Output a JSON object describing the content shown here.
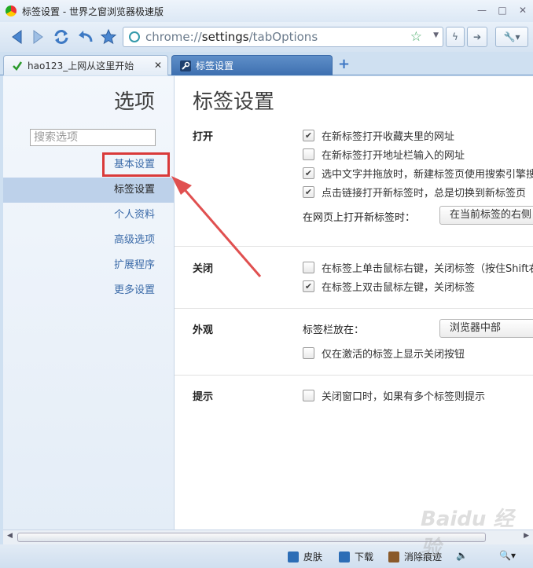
{
  "window": {
    "title": "标签设置 - 世界之窗浏览器极速版",
    "controls": [
      "—",
      "□",
      "✕"
    ]
  },
  "toolbar": {
    "url_scheme": "chrome://",
    "url_host": "settings",
    "url_path": "/tabOptions"
  },
  "tabs": [
    {
      "label": "hao123_上网从这里开始",
      "close": "✕"
    },
    {
      "label": "标签设置",
      "close": ""
    }
  ],
  "sidebar": {
    "title": "选项",
    "search_placeholder": "搜索选项",
    "items": [
      {
        "label": "基本设置"
      },
      {
        "label": "标签设置"
      },
      {
        "label": "个人资料"
      },
      {
        "label": "高级选项"
      },
      {
        "label": "扩展程序"
      },
      {
        "label": "更多设置"
      }
    ]
  },
  "main": {
    "title": "标签设置",
    "sections": {
      "open": {
        "label": "打开",
        "options": [
          {
            "label": "在新标签打开收藏夹里的网址",
            "checked": true
          },
          {
            "label": "在新标签打开地址栏输入的网址",
            "checked": false
          },
          {
            "label": "选中文字并拖放时，新建标签页使用搜索引擎搜",
            "checked": true
          },
          {
            "label": "点击链接打开新标签时，总是切换到新标签页",
            "checked": true
          }
        ],
        "new_tab_position_label": "在网页上打开新标签时：",
        "new_tab_position_value": "在当前标签的右侧"
      },
      "close": {
        "label": "关闭",
        "options": [
          {
            "label": "在标签上单击鼠标右键，关闭标签（按住Shift右",
            "checked": false
          },
          {
            "label": "在标签上双击鼠标左键，关闭标签",
            "checked": true
          }
        ]
      },
      "appearance": {
        "label": "外观",
        "tabbar_label": "标签栏放在：",
        "tabbar_value": "浏览器中部",
        "options": [
          {
            "label": "仅在激活的标签上显示关闭按钮",
            "checked": false
          }
        ]
      },
      "prompt": {
        "label": "提示",
        "options": [
          {
            "label": "关闭窗口时，如果有多个标签则提示",
            "checked": false
          }
        ]
      }
    }
  },
  "statusbar": {
    "skin": "皮肤",
    "download": "下载",
    "clear_traces": "消除痕迹",
    "watermark": "Baidu 经验"
  },
  "colors": {
    "accent": "#3a6aa8",
    "annotation_red": "#d93a3a",
    "active_tab": "#4a7dbd"
  }
}
